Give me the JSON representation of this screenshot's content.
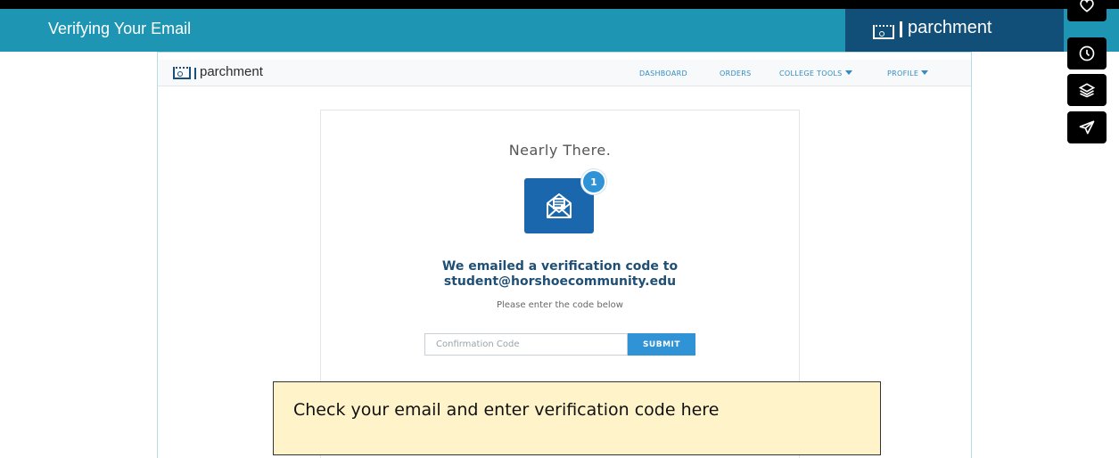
{
  "header": {
    "title": "Verifying Your Email",
    "logo_text": "parchment"
  },
  "side_toolbar": {
    "icons": [
      "heart-icon",
      "clock-icon",
      "layers-icon",
      "send-icon"
    ]
  },
  "nav": {
    "logo_text": "parchment",
    "links": {
      "dashboard": "DASHBOARD",
      "orders": "ORDERS",
      "college_tools": "COLLEGE TOOLS",
      "profile": "PROFILE"
    }
  },
  "card": {
    "heading": "Nearly There.",
    "badge_count": "1",
    "message_line1": "We emailed a verification code to",
    "email": "student@horshoecommunity.edu",
    "instruction": "Please enter the code below",
    "input_placeholder": "Confirmation Code",
    "input_value": "",
    "submit_label": "SUBMIT"
  },
  "callout": {
    "text": "Check your email and enter verification code here"
  },
  "colors": {
    "header_teal": "#1e95b3",
    "logo_navy": "#114f78",
    "link_blue": "#2f8cc7",
    "tile_blue": "#1a67ad",
    "callout_bg": "#fff3c9"
  }
}
